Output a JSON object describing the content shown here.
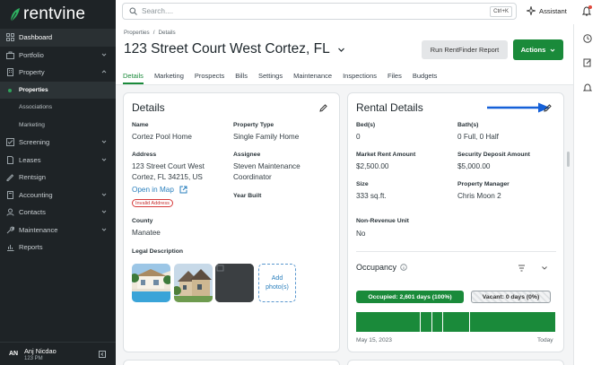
{
  "brand": {
    "name": "rentvine",
    "accent": "#1a8a3a"
  },
  "sidebar": {
    "items": [
      {
        "label": "Dashboard",
        "icon": "grid-icon"
      },
      {
        "label": "Portfolio",
        "icon": "briefcase-icon",
        "chevron": "down"
      },
      {
        "label": "Property",
        "icon": "building-icon",
        "chevron": "up"
      },
      {
        "label": "Screening",
        "icon": "checklist-icon",
        "chevron": "down"
      },
      {
        "label": "Leases",
        "icon": "document-icon",
        "chevron": "down"
      },
      {
        "label": "Rentsign",
        "icon": "sign-icon"
      },
      {
        "label": "Accounting",
        "icon": "calculator-icon",
        "chevron": "down"
      },
      {
        "label": "Contacts",
        "icon": "contacts-icon",
        "chevron": "down"
      },
      {
        "label": "Maintenance",
        "icon": "wrench-icon",
        "chevron": "down"
      },
      {
        "label": "Reports",
        "icon": "chart-icon"
      }
    ],
    "sub_items": [
      "Properties",
      "Associations",
      "Marketing"
    ],
    "user": {
      "initials": "AN",
      "name": "Anj Nicdao",
      "time": "123 PM"
    }
  },
  "topbar": {
    "search_placeholder": "Search....",
    "shortcut": "Ctrl+K",
    "assistant": "Assistant"
  },
  "page": {
    "breadcrumbs": [
      "Properties",
      "/",
      "Details"
    ],
    "title": "123 Street Court West Cortez, FL",
    "rentfinder_button": "Run RentFinder Report",
    "actions_button": "Actions",
    "tabs": [
      "Details",
      "Marketing",
      "Prospects",
      "Bills",
      "Settings",
      "Maintenance",
      "Inspections",
      "Files",
      "Budgets"
    ]
  },
  "details": {
    "title": "Details",
    "name_label": "Name",
    "name_value": "Cortez Pool Home",
    "type_label": "Property Type",
    "type_value": "Single Family Home",
    "address_label": "Address",
    "address_line1": "123 Street Court West",
    "address_line2": "Cortez, FL 34215, US",
    "open_map": "Open in Map",
    "invalid_badge": "Invalid Address",
    "assignee_label": "Assignee",
    "assignee_line1": "Steven Maintenance",
    "assignee_line2": "Coordinator",
    "year_label": "Year Built",
    "county_label": "County",
    "county_value": "Manatee",
    "legal_label": "Legal Description",
    "add_photo": "Add photo(s)"
  },
  "rental": {
    "title": "Rental Details",
    "bed_label": "Bed(s)",
    "bed_value": "0",
    "bath_label": "Bath(s)",
    "bath_value": "0 Full, 0 Half",
    "rent_label": "Market Rent Amount",
    "rent_value": "$2,500.00",
    "deposit_label": "Security Deposit Amount",
    "deposit_value": "$5,000.00",
    "size_label": "Size",
    "size_value": "333 sq.ft.",
    "manager_label": "Property Manager",
    "manager_value": "Chris Moon 2",
    "nonrev_label": "Non-Revenue Unit",
    "nonrev_value": "No",
    "occupancy_title": "Occupancy",
    "occupied": "Occupied: 2,601 days (100%)",
    "vacant": "Vacant: 0 days (0%)",
    "start_date": "May 15, 2023",
    "end_label": "Today"
  }
}
